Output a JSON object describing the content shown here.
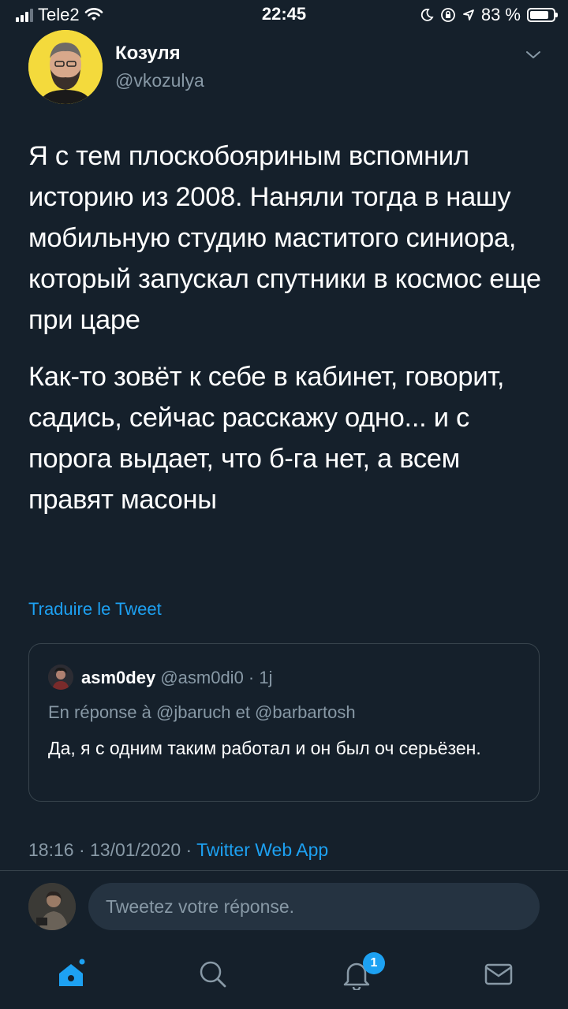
{
  "status_bar": {
    "carrier": "Tele2",
    "time": "22:45",
    "battery": "83 %",
    "battery_level": 0.83
  },
  "tweet": {
    "author_name": "Козуля",
    "author_handle": "@vkozulya",
    "paragraphs": [
      "Я с тем плоскобояриным вспомнил историю из 2008. Наняли тогда в нашу мобильную студию маститого синиора, который запускал спутники в космос еще при царе",
      "Как-то зовёт к себе в кабинет, говорит, садись, сейчас расскажу одно... и с порога выдает, что б-га нет, а всем правят масоны"
    ],
    "translate_link": "Traduire le Tweet",
    "timestamp": "18:16 · 13/01/2020 · ",
    "source": "Twitter Web App"
  },
  "quote": {
    "name": "asm0dey",
    "meta": "@asm0di0 · 1j",
    "reply_to": "En réponse à @jbaruch et @barbartosh",
    "text": "Да, я с одним таким работал и он был оч серьёзен."
  },
  "reply": {
    "placeholder": "Tweetez votre réponse."
  },
  "tabbar": {
    "notification_count": "1",
    "icons": [
      "home-icon",
      "search-icon",
      "notifications-icon",
      "messages-icon"
    ],
    "active_color": "#1da1f2"
  },
  "colors": {
    "background": "#15202b",
    "accent": "#1da1f2",
    "secondary_text": "#8899a6"
  }
}
